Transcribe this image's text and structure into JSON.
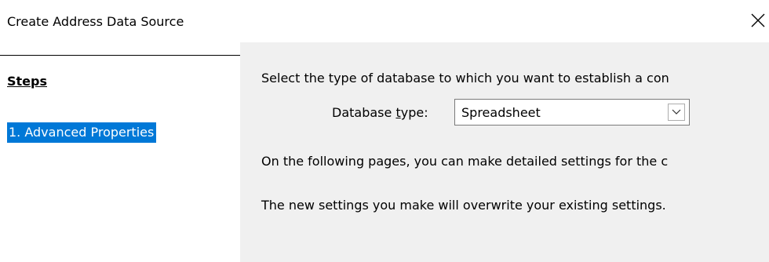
{
  "dialog": {
    "title": "Create Address Data Source",
    "close_icon": "close-icon"
  },
  "steps": {
    "heading": "Steps",
    "items": [
      {
        "label": "1. Advanced Properties",
        "selected": true
      }
    ]
  },
  "main": {
    "intro": "Select the type of database to which you want to establish a con",
    "database_type": {
      "label_before": "Database ",
      "label_mnemonic": "t",
      "label_after": "ype:",
      "value": "Spreadsheet",
      "dropdown_icon": "chevron-down-icon"
    },
    "line2": "On the following pages, you can make detailed settings for the c",
    "line3": "The new settings you make will overwrite your existing settings."
  },
  "colors": {
    "selection": "#0078d7",
    "panel_bg": "#f0f0f0"
  }
}
